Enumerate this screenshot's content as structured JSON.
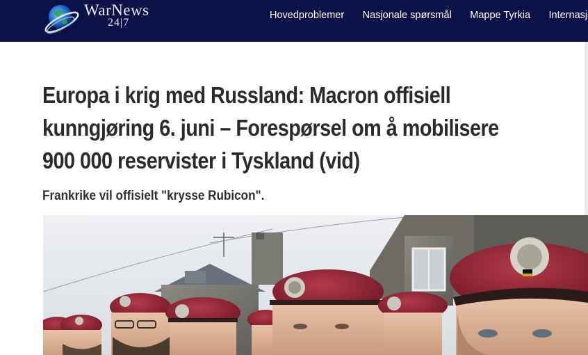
{
  "site": {
    "logo_title": "WarNews",
    "logo_sub": "24|7"
  },
  "nav": {
    "items": [
      {
        "label": "Hovedproblemer"
      },
      {
        "label": "Nasjonale spørsmål"
      },
      {
        "label": "Mappe Tyrkia"
      },
      {
        "label": "Internasjonale"
      }
    ]
  },
  "article": {
    "title": "Europa i krig med Russland: Macron offisiell kunngjøring 6. juni – Forespørsel om å mobilisere 900 000 reservister i Tyskland (vid)",
    "subtitle": "Frankrike vil offisielt \"krysse Rubicon\"."
  },
  "colors": {
    "header_bg": "#0c1147",
    "beret": "#8a1f2e"
  },
  "icons": {
    "logo": "globe-logo-icon"
  }
}
